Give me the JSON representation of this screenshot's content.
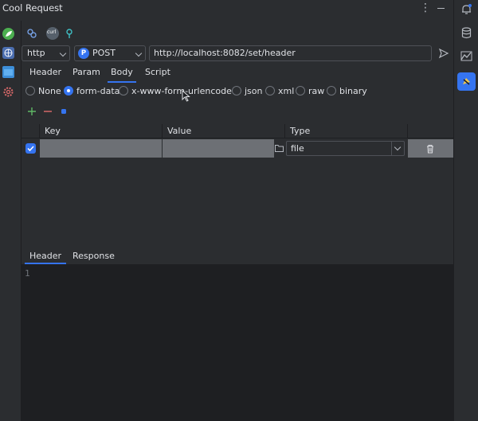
{
  "window": {
    "title": "Cool Request"
  },
  "icons": {
    "more": "more-vertical-icon",
    "minimize": "minimize-icon",
    "send": "send-icon"
  },
  "request": {
    "scheme": "http",
    "method": "POST",
    "method_badge": "P",
    "url": "http://localhost:8082/set/header"
  },
  "toolbar": {
    "curl_label": "curl"
  },
  "tabs": [
    {
      "label": "Header",
      "active": false
    },
    {
      "label": "Param",
      "active": false
    },
    {
      "label": "Body",
      "active": true
    },
    {
      "label": "Script",
      "active": false
    }
  ],
  "body_types": [
    {
      "label": "None",
      "selected": false
    },
    {
      "label": "form-data",
      "selected": true
    },
    {
      "label": "x-www-form-urlencoded",
      "selected": false
    },
    {
      "label": "json",
      "selected": false
    },
    {
      "label": "xml",
      "selected": false
    },
    {
      "label": "raw",
      "selected": false
    },
    {
      "label": "binary",
      "selected": false
    }
  ],
  "table": {
    "headers": {
      "key": "Key",
      "value": "Value",
      "type": "Type"
    },
    "rows": [
      {
        "checked": true,
        "key": "",
        "value": "",
        "type": "file"
      }
    ]
  },
  "response": {
    "tabs": [
      {
        "label": "Header",
        "active": true
      },
      {
        "label": "Response",
        "active": false
      }
    ],
    "line_number": "1"
  },
  "colors": {
    "background": "#2b2d30",
    "editor": "#1e1f22",
    "accent": "#3574f0",
    "add": "#5fb865",
    "remove": "#e06c6c"
  }
}
